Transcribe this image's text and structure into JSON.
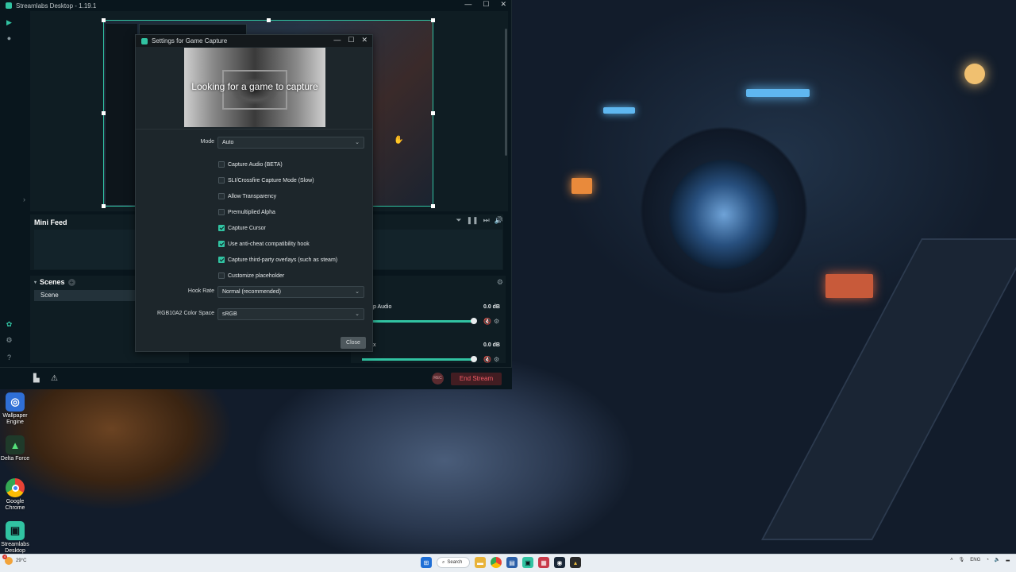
{
  "app": {
    "title": "Streamlabs Desktop - 1.19.1",
    "win_min": "—",
    "win_max": "☐",
    "win_close": "✕"
  },
  "minifeed": {
    "title": "Mini Feed"
  },
  "scenes": {
    "title": "Scenes",
    "items": [
      "Scene"
    ]
  },
  "mixer": {
    "rows": [
      {
        "name": "p Audio",
        "db": "0.0 dB"
      },
      {
        "name": "x",
        "db": "0.0 dB"
      }
    ]
  },
  "footer": {
    "rec_label": "REC",
    "end_stream_label": "End Stream"
  },
  "dialog": {
    "title": "Settings for Game Capture",
    "preview_text": "Looking for a game to capture",
    "mode_label": "Mode",
    "mode_value": "Auto",
    "checkboxes": [
      {
        "label": "Capture Audio (BETA)",
        "checked": false
      },
      {
        "label": "SLI/Crossfire Capture Mode (Slow)",
        "checked": false
      },
      {
        "label": "Allow Transparency",
        "checked": false
      },
      {
        "label": "Premultiplied Alpha",
        "checked": false
      },
      {
        "label": "Capture Cursor",
        "checked": true
      },
      {
        "label": "Use anti-cheat compatibility hook",
        "checked": true
      },
      {
        "label": "Capture third-party overlays (such as steam)",
        "checked": true
      },
      {
        "label": "Customize placeholder",
        "checked": false
      }
    ],
    "hook_rate_label": "Hook Rate",
    "hook_rate_value": "Normal (recommended)",
    "color_space_label": "RGB10A2 Color Space",
    "color_space_value": "sRGB",
    "close_label": "Close"
  },
  "desktop_icons": [
    {
      "label": "Wallpaper Engine",
      "icon": "wallpaper-engine-icon",
      "color": "#2f6fd6"
    },
    {
      "label": "Delta Force",
      "icon": "delta-force-icon",
      "color": "#1f3a2a"
    },
    {
      "label": "Google Chrome",
      "icon": "chrome-icon",
      "color": "#e94235"
    },
    {
      "label": "Streamlabs Desktop",
      "icon": "streamlabs-icon",
      "color": "#31c3a2"
    }
  ],
  "taskbar": {
    "weather_temp": "29°C",
    "weather_badge": "4",
    "search_label": "Search",
    "lang": "ENG"
  },
  "colors": {
    "accent": "#31c3a2",
    "end_stream": "#f25c66",
    "panel": "#0f1d23",
    "dialog": "#1d262b"
  }
}
